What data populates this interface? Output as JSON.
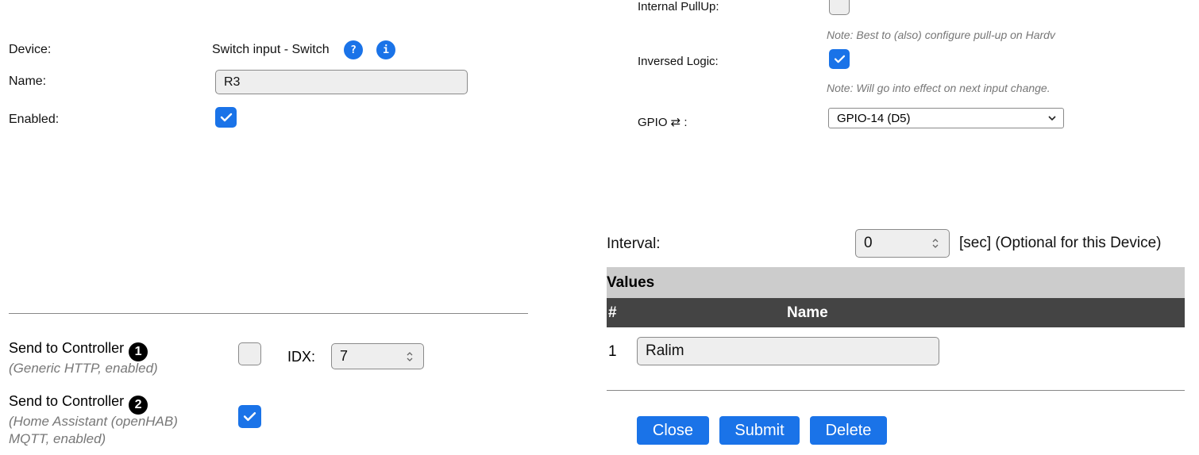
{
  "device": {
    "device_label": "Device:",
    "device_value": "Switch input - Switch",
    "help_icon": "question-icon",
    "info_icon": "info-icon",
    "name_label": "Name:",
    "name_value": "R3",
    "enabled_label": "Enabled:",
    "enabled_checked": true
  },
  "sensor": {
    "pullup_label": "Internal PullUp:",
    "pullup_checked": false,
    "pullup_note": "Note: Best to (also) configure pull-up on Hardv",
    "inversed_label": "Inversed Logic:",
    "inversed_checked": true,
    "inversed_note": "Note: Will go into effect on next input change.",
    "gpio_label": "GPIO ⇄ :",
    "gpio_value": "GPIO-14 (D5)"
  },
  "interval": {
    "label": "Interval:",
    "value": "0",
    "suffix": "[sec] (Optional for this Device)"
  },
  "values": {
    "section_title": "Values",
    "col_num": "#",
    "col_name": "Name",
    "rows": [
      {
        "num": "1",
        "name": "Ralim"
      }
    ]
  },
  "controllers": [
    {
      "title": "Send to Controller",
      "badge": "1",
      "description": "(Generic HTTP, enabled)",
      "checked": false,
      "idx_label": "IDX:",
      "idx_value": "7"
    },
    {
      "title": "Send to Controller",
      "badge": "2",
      "description_line1": "(Home Assistant (openHAB)",
      "description_line2": "MQTT, enabled)",
      "checked": true
    }
  ],
  "buttons": {
    "close": "Close",
    "submit": "Submit",
    "delete": "Delete"
  },
  "colors": {
    "accent": "#1a73e8",
    "section_header": "#cccccc",
    "table_header": "#444444"
  }
}
